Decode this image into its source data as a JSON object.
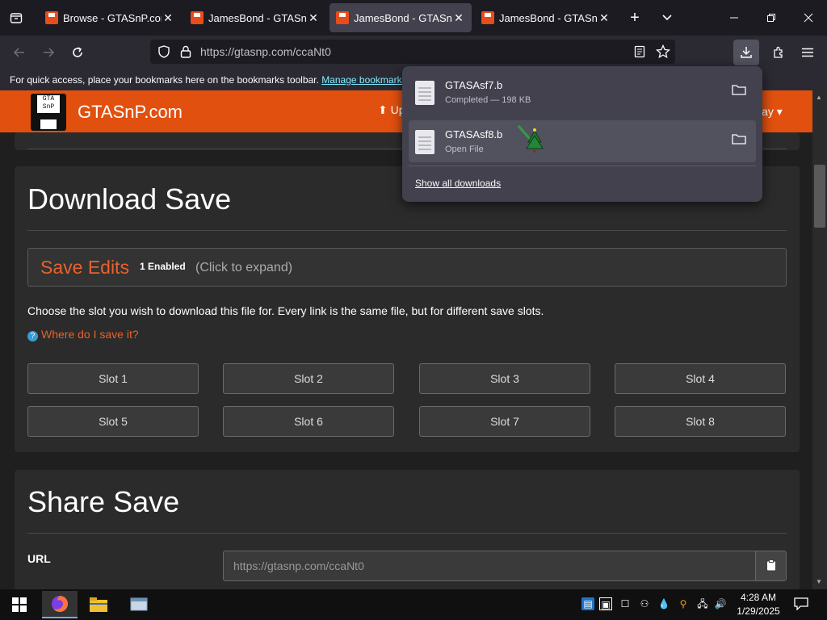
{
  "browser": {
    "tabs": [
      {
        "title": "Browse - GTASnP.com"
      },
      {
        "title": "JamesBond - GTASnP.com"
      },
      {
        "title": "JamesBond - GTASnP.com"
      },
      {
        "title": "JamesBond - GTASnP.com"
      }
    ],
    "url": "https://gtasnp.com/ccaNt0",
    "bookmarks_text": "For quick access, place your bookmarks here on the bookmarks toolbar.",
    "bookmarks_link": "Manage bookmarks…"
  },
  "site": {
    "name": "GTASnP.com",
    "logo_text": "GTA SnP",
    "upload_partial": "Up",
    "play_partial": "lay"
  },
  "download_save": {
    "heading": "Download Save",
    "save_edits": {
      "title": "Save Edits",
      "badge": "1 Enabled",
      "hint": "(Click to expand)"
    },
    "description": "Choose the slot you wish to download this file for. Every link is the same file, but for different save slots.",
    "where_link": "Where do I save it?",
    "slots": [
      "Slot 1",
      "Slot 2",
      "Slot 3",
      "Slot 4",
      "Slot 5",
      "Slot 6",
      "Slot 7",
      "Slot 8"
    ]
  },
  "share_save": {
    "heading": "Share Save",
    "url_label": "URL",
    "url_value": "https://gtasnp.com/ccaNt0"
  },
  "downloads_panel": {
    "items": [
      {
        "name": "GTASAsf7.b",
        "status": "Completed — 198 KB"
      },
      {
        "name": "GTASAsf8.b",
        "status": "Open File"
      }
    ],
    "show_all": "Show all downloads"
  },
  "taskbar": {
    "time": "4:28 AM",
    "date": "1/29/2025"
  }
}
